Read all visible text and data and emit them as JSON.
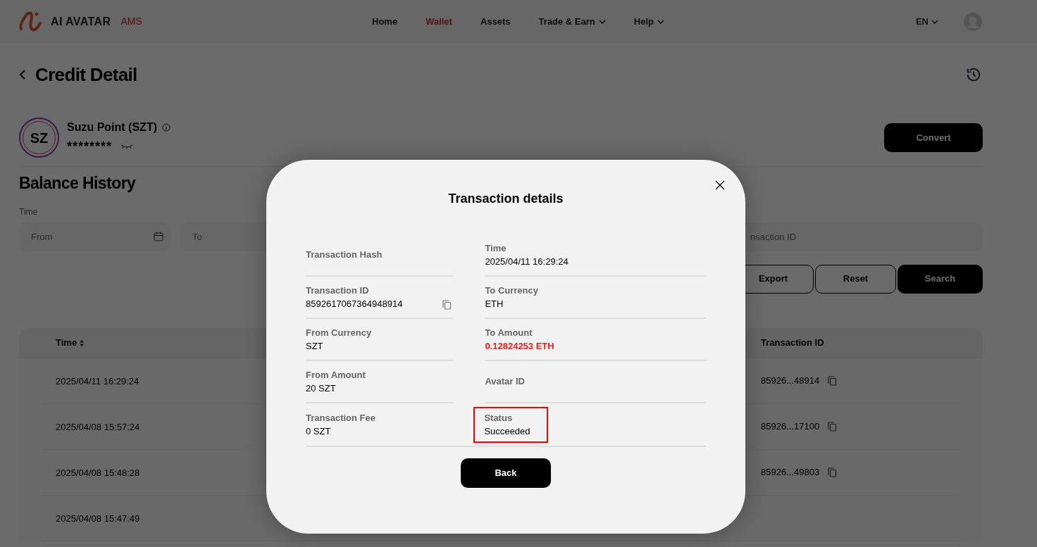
{
  "brand": {
    "name": "AI AVATAR",
    "suffix": "AMS"
  },
  "nav": [
    {
      "label": "Home",
      "selected": false
    },
    {
      "label": "Wallet",
      "selected": true
    },
    {
      "label": "Assets",
      "selected": false
    },
    {
      "label": "Trade & Earn",
      "selected": false,
      "dropdown": true
    },
    {
      "label": "Help",
      "selected": false,
      "dropdown": true
    }
  ],
  "language": "EN",
  "page": {
    "title": "Credit Detail"
  },
  "token": {
    "logo_text": "SZ",
    "name": "Suzu Point (SZT)",
    "balance": "********"
  },
  "convert_button": "Convert",
  "balance_history": {
    "title": "Balance History",
    "time_label": "Time",
    "from_placeholder": "From",
    "to_placeholder": "To",
    "search_placeholder": "nsaction ID"
  },
  "buttons": [
    "Export",
    "Reset",
    "Search"
  ],
  "table": {
    "columns": [
      "Time",
      "Transaction ID"
    ],
    "rows": [
      {
        "time": "2025/04/11 16:29:24",
        "transaction_id": "85926...48914"
      },
      {
        "time": "2025/04/08 15:57:24",
        "transaction_id": "85926...17100"
      },
      {
        "time": "2025/04/08 15:48:28",
        "transaction_id": "85926...49803"
      },
      {
        "time": "2025/04/08 15:47:49"
      }
    ]
  },
  "dialog": {
    "title": "Transaction details",
    "left_fields": [
      {
        "label": "Transaction Hash"
      },
      {
        "label": "Transaction ID",
        "value": "8592617067364948914",
        "copyable": true
      },
      {
        "label": "From Currency",
        "value": "SZT"
      },
      {
        "label": "From Amount",
        "value": "20 SZT"
      },
      {
        "label": "Transaction Fee",
        "value": "0 SZT"
      }
    ],
    "right_fields": [
      {
        "label": "Time",
        "value": "2025/04/11 16:29:24"
      },
      {
        "label": "To Currency",
        "value": "ETH"
      },
      {
        "label": "To Amount",
        "value": "0.12824253 ETH",
        "emphasis": true
      },
      {
        "label": "Avatar ID"
      },
      {
        "label": "Status",
        "value": "Succeeded",
        "highlighted": true
      }
    ],
    "back_button": "Back"
  }
}
